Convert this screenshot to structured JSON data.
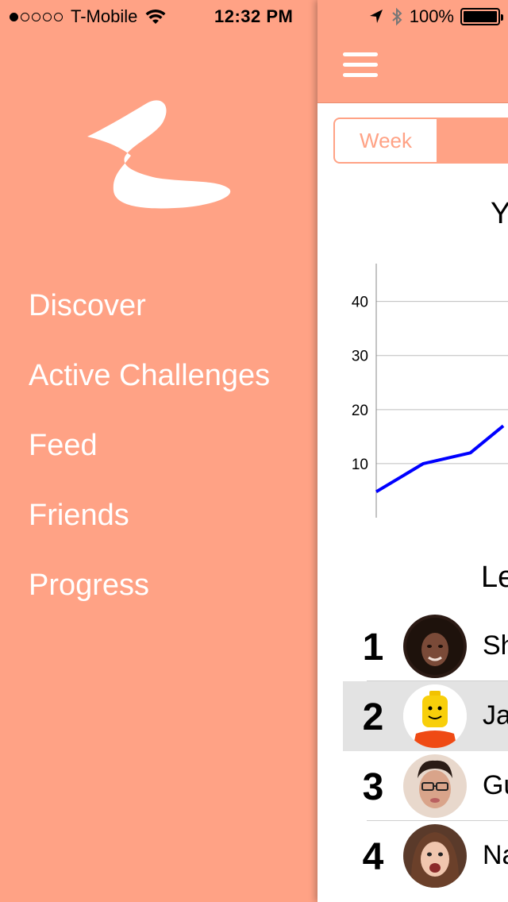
{
  "status_bar": {
    "carrier": "T-Mobile",
    "time": "12:32 PM",
    "battery": "100%",
    "signal_dots_filled": 1,
    "signal_dots_total": 5,
    "icons": [
      "wifi-icon",
      "location-arrow-icon",
      "bluetooth-icon",
      "battery-icon"
    ]
  },
  "side_menu": {
    "logo": "pelican-logo",
    "items": [
      {
        "label": "Discover"
      },
      {
        "label": "Active Challenges"
      },
      {
        "label": "Feed"
      },
      {
        "label": "Friends"
      },
      {
        "label": "Progress"
      }
    ]
  },
  "content": {
    "nav": {
      "menu_icon": "hamburger-icon"
    },
    "segment": {
      "options": [
        "Week",
        ""
      ],
      "selected_index": 1
    },
    "chart_title": "Y",
    "leaderboard_title": "Le",
    "leaderboard": [
      {
        "rank": "1",
        "name": "Sh",
        "avatar": "woman-curly-hair-avatar"
      },
      {
        "rank": "2",
        "name": "Ja",
        "avatar": "lego-figure-avatar",
        "highlighted": true
      },
      {
        "rank": "3",
        "name": "Gu",
        "avatar": "man-glasses-avatar"
      },
      {
        "rank": "4",
        "name": "Na",
        "avatar": "woman-smiling-avatar"
      }
    ]
  },
  "colors": {
    "accent": "#FFA285",
    "line": "#0000FF",
    "highlight_row": "#E3E3E3"
  },
  "chart_data": {
    "type": "line",
    "title": "",
    "y_ticks": [
      10,
      20,
      30,
      40
    ],
    "ylim": [
      0,
      47
    ],
    "grid": true,
    "series": [
      {
        "points": [
          [
            0,
            4.8
          ],
          [
            1,
            10
          ],
          [
            2,
            12
          ],
          [
            2.7,
            17
          ]
        ]
      }
    ],
    "xlim": [
      0,
      2.8
    ]
  }
}
